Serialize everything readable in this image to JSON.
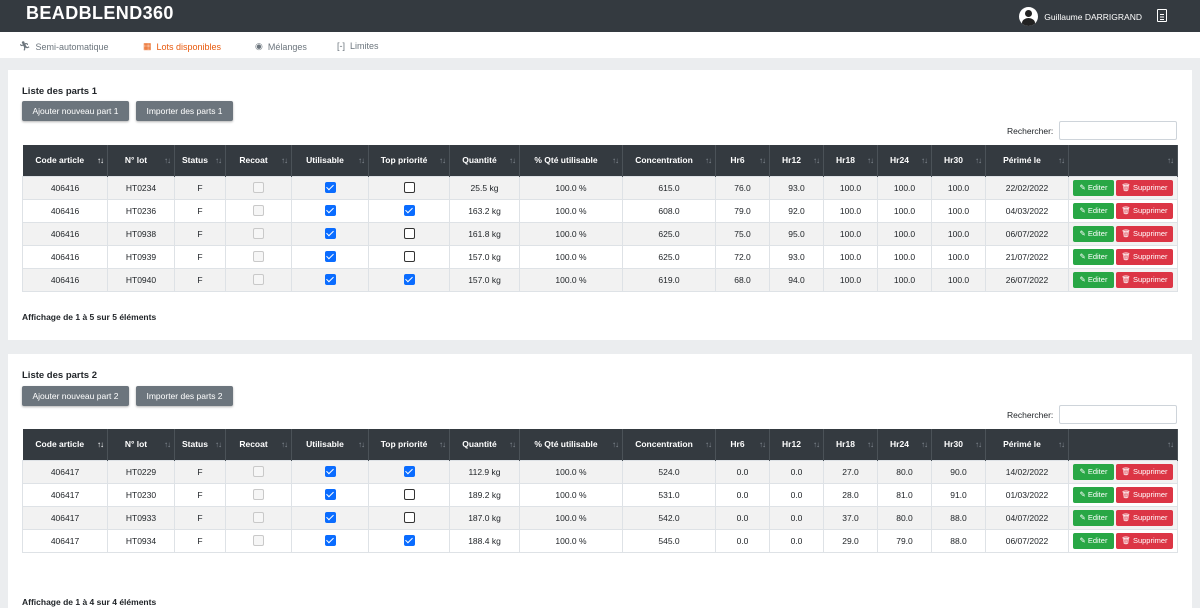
{
  "header": {
    "brand": "BEADBLEND360",
    "user_name": "Guillaume DARRIGRAND",
    "icons": [
      "avatar",
      "document-icon"
    ]
  },
  "tabs": [
    {
      "label": "Semi-automatique",
      "icon": "running-person-icon",
      "active": false
    },
    {
      "label": "Lots disponibles",
      "icon": "table-icon",
      "active": true
    },
    {
      "label": "Mélanges",
      "icon": "circle-dot-icon",
      "active": false
    },
    {
      "label": "Limites",
      "icon": "brackets-icon",
      "active": false
    }
  ],
  "colors": {
    "accent": "#e8590c",
    "header_bg": "#343a40",
    "edit": "#28a745",
    "delete": "#dc3545",
    "checkbox": "#0a6cff"
  },
  "columns": [
    "Code article",
    "N° lot",
    "Status",
    "Recoat",
    "Utilisable",
    "Top priorité",
    "Quantité",
    "% Qté utilisable",
    "Concentration",
    "Hr6",
    "Hr12",
    "Hr18",
    "Hr24",
    "Hr30",
    "Périmé le",
    ""
  ],
  "actions": {
    "edit": "Editer",
    "delete": "Supprimer"
  },
  "search_label": "Rechercher:",
  "panels": [
    {
      "title": "Liste des parts 1",
      "add_button": "Ajouter nouveau part 1",
      "import_button": "Importer des parts 1",
      "info": "Affichage de 1 à 5 sur 5 éléments",
      "rows": [
        {
          "code": "406416",
          "lot": "HT0234",
          "status": "F",
          "utilisable": true,
          "top": false,
          "quantite": "25.5 kg",
          "pct": "100.0 %",
          "conc": "615.0",
          "hr6": "76.0",
          "hr12": "93.0",
          "hr18": "100.0",
          "hr24": "100.0",
          "hr30": "100.0",
          "perime": "22/02/2022"
        },
        {
          "code": "406416",
          "lot": "HT0236",
          "status": "F",
          "utilisable": true,
          "top": true,
          "quantite": "163.2 kg",
          "pct": "100.0 %",
          "conc": "608.0",
          "hr6": "79.0",
          "hr12": "92.0",
          "hr18": "100.0",
          "hr24": "100.0",
          "hr30": "100.0",
          "perime": "04/03/2022"
        },
        {
          "code": "406416",
          "lot": "HT0938",
          "status": "F",
          "utilisable": true,
          "top": false,
          "quantite": "161.8 kg",
          "pct": "100.0 %",
          "conc": "625.0",
          "hr6": "75.0",
          "hr12": "95.0",
          "hr18": "100.0",
          "hr24": "100.0",
          "hr30": "100.0",
          "perime": "06/07/2022"
        },
        {
          "code": "406416",
          "lot": "HT0939",
          "status": "F",
          "utilisable": true,
          "top": false,
          "quantite": "157.0 kg",
          "pct": "100.0 %",
          "conc": "625.0",
          "hr6": "72.0",
          "hr12": "93.0",
          "hr18": "100.0",
          "hr24": "100.0",
          "hr30": "100.0",
          "perime": "21/07/2022"
        },
        {
          "code": "406416",
          "lot": "HT0940",
          "status": "F",
          "utilisable": true,
          "top": true,
          "quantite": "157.0 kg",
          "pct": "100.0 %",
          "conc": "619.0",
          "hr6": "68.0",
          "hr12": "94.0",
          "hr18": "100.0",
          "hr24": "100.0",
          "hr30": "100.0",
          "perime": "26/07/2022"
        }
      ]
    },
    {
      "title": "Liste des parts 2",
      "add_button": "Ajouter nouveau part 2",
      "import_button": "Importer des parts 2",
      "info": "Affichage de 1 à 4 sur 4 éléments",
      "rows": [
        {
          "code": "406417",
          "lot": "HT0229",
          "status": "F",
          "utilisable": true,
          "top": true,
          "quantite": "112.9 kg",
          "pct": "100.0 %",
          "conc": "524.0",
          "hr6": "0.0",
          "hr12": "0.0",
          "hr18": "27.0",
          "hr24": "80.0",
          "hr30": "90.0",
          "perime": "14/02/2022"
        },
        {
          "code": "406417",
          "lot": "HT0230",
          "status": "F",
          "utilisable": true,
          "top": false,
          "quantite": "189.2 kg",
          "pct": "100.0 %",
          "conc": "531.0",
          "hr6": "0.0",
          "hr12": "0.0",
          "hr18": "28.0",
          "hr24": "81.0",
          "hr30": "91.0",
          "perime": "01/03/2022"
        },
        {
          "code": "406417",
          "lot": "HT0933",
          "status": "F",
          "utilisable": true,
          "top": false,
          "quantite": "187.0 kg",
          "pct": "100.0 %",
          "conc": "542.0",
          "hr6": "0.0",
          "hr12": "0.0",
          "hr18": "37.0",
          "hr24": "80.0",
          "hr30": "88.0",
          "perime": "04/07/2022"
        },
        {
          "code": "406417",
          "lot": "HT0934",
          "status": "F",
          "utilisable": true,
          "top": true,
          "quantite": "188.4 kg",
          "pct": "100.0 %",
          "conc": "545.0",
          "hr6": "0.0",
          "hr12": "0.0",
          "hr18": "29.0",
          "hr24": "79.0",
          "hr30": "88.0",
          "perime": "06/07/2022"
        }
      ]
    }
  ]
}
